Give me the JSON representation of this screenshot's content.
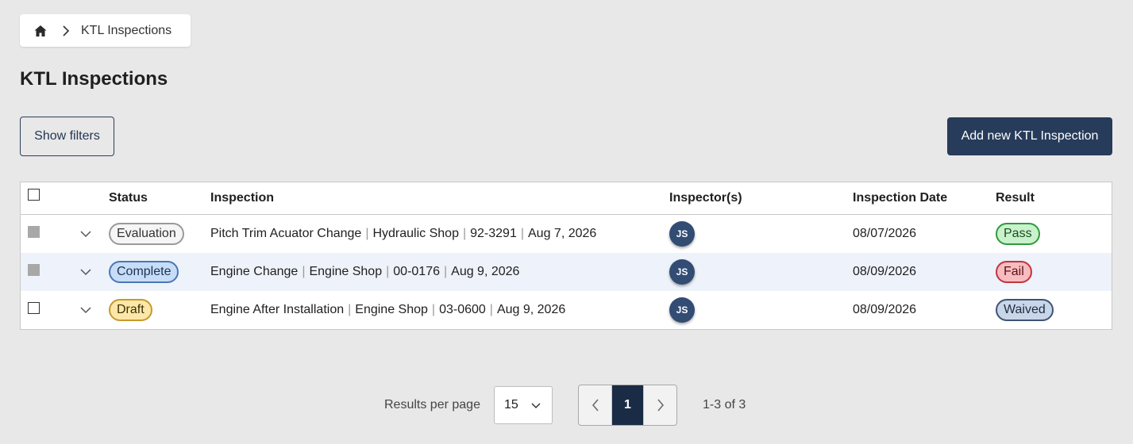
{
  "breadcrumb": {
    "home_icon": "home-icon",
    "current": "KTL Inspections"
  },
  "page": {
    "title": "KTL Inspections"
  },
  "toolbar": {
    "show_filters_label": "Show filters",
    "add_new_label": "Add new KTL Inspection"
  },
  "table": {
    "headers": {
      "status": "Status",
      "inspection": "Inspection",
      "inspectors": "Inspector(s)",
      "date": "Inspection Date",
      "result": "Result"
    },
    "rows": [
      {
        "status": "Evaluation",
        "inspection": {
          "title": "Pitch Trim Acuator Change",
          "shop": "Hydraulic Shop",
          "code": "92-3291",
          "date": "Aug 7, 2026"
        },
        "inspector_initials": "JS",
        "inspection_date": "08/07/2026",
        "result": "Pass"
      },
      {
        "status": "Complete",
        "inspection": {
          "title": "Engine Change",
          "shop": "Engine Shop",
          "code": "00-0176",
          "date": "Aug 9, 2026"
        },
        "inspector_initials": "JS",
        "inspection_date": "08/09/2026",
        "result": "Fail"
      },
      {
        "status": "Draft",
        "inspection": {
          "title": "Engine After Installation",
          "shop": "Engine Shop",
          "code": "03-0600",
          "date": "Aug 9, 2026"
        },
        "inspector_initials": "JS",
        "inspection_date": "08/09/2026",
        "result": "Waived"
      }
    ]
  },
  "pagination": {
    "results_per_page_label": "Results per page",
    "results_per_page_value": "15",
    "current_page": "1",
    "range_label": "1-3 of 3"
  },
  "colors": {
    "primary": "#273b5a",
    "avatar": "#324c73",
    "alt_row": "#eef2fa"
  }
}
